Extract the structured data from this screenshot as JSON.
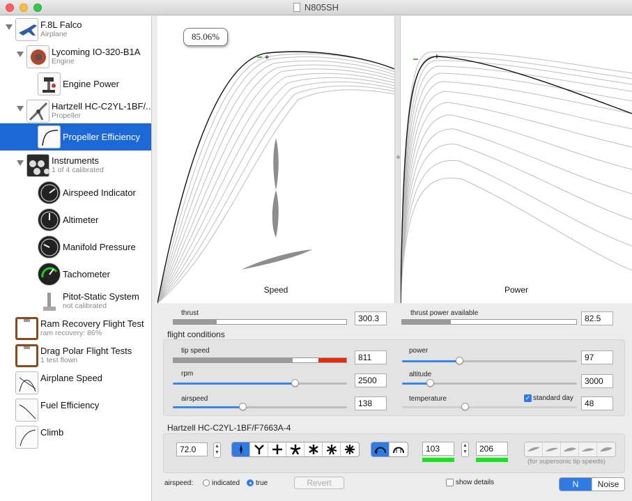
{
  "window": {
    "title": "N805SH"
  },
  "sidebar": {
    "items": [
      {
        "label": "F.8L Falco",
        "sub": "Airplane"
      },
      {
        "label": "Lycoming IO-320-B1A",
        "sub": "Engine"
      },
      {
        "label": "Engine Power",
        "sub": ""
      },
      {
        "label": "Hartzell HC-C2YL-1BF/...",
        "sub": "Propeller"
      },
      {
        "label": "Propeller Efficiency",
        "sub": ""
      },
      {
        "label": "Instruments",
        "sub": "1 of 4 calibrated"
      },
      {
        "label": "Airspeed Indicator",
        "sub": ""
      },
      {
        "label": "Altimeter",
        "sub": ""
      },
      {
        "label": "Manifold Pressure",
        "sub": ""
      },
      {
        "label": "Tachometer",
        "sub": ""
      },
      {
        "label": "Pitot-Static System",
        "sub": "not calibrated"
      },
      {
        "label": "Ram Recovery Flight Test",
        "sub": "ram recovery: 86%"
      },
      {
        "label": "Drag Polar Flight Tests",
        "sub": "1 test flown"
      },
      {
        "label": "Airplane Speed",
        "sub": ""
      },
      {
        "label": "Fuel Efficiency",
        "sub": ""
      },
      {
        "label": "Climb",
        "sub": ""
      }
    ]
  },
  "graphs": {
    "left_title": "Speed",
    "right_title": "Power",
    "efficiency_readout": "85.06%"
  },
  "thrust": {
    "label": "thrust",
    "value": "300.3",
    "fill": 0.25
  },
  "thrust_power": {
    "label": "thrust power available",
    "value": "82.5",
    "fill": 0.28
  },
  "flight_conditions": {
    "title": "flight conditions",
    "tip_speed": {
      "label": "tip speed",
      "value": "811"
    },
    "rpm": {
      "label": "rpm",
      "value": "2500",
      "level": 0.7
    },
    "airspeed": {
      "label": "airspeed",
      "value": "138",
      "level": 0.4
    },
    "power": {
      "label": "power",
      "value": "97",
      "level": 0.33
    },
    "altitude": {
      "label": "altitude",
      "value": "3000",
      "level": 0.16
    },
    "temperature": {
      "label": "temperature",
      "value": "48",
      "level": 0.36
    },
    "standard_day": {
      "label": "standard day",
      "checked": true
    }
  },
  "propeller": {
    "title": "Hartzell HC-C2YL-1BF/F7663A-4",
    "diameter": "72.0",
    "field1": "103",
    "field2": "206",
    "supersonic_note": "(for supersonic tip speeds)"
  },
  "footer": {
    "airspeed_label": "airspeed:",
    "indicated": "indicated",
    "true_label": "true",
    "revert": "Revert",
    "show_details": "show details",
    "unit_n": "N",
    "unit_noise": "Noise"
  },
  "colors": {
    "accent": "#1b68d6",
    "green": "#16e51a",
    "red": "#e52b12"
  }
}
